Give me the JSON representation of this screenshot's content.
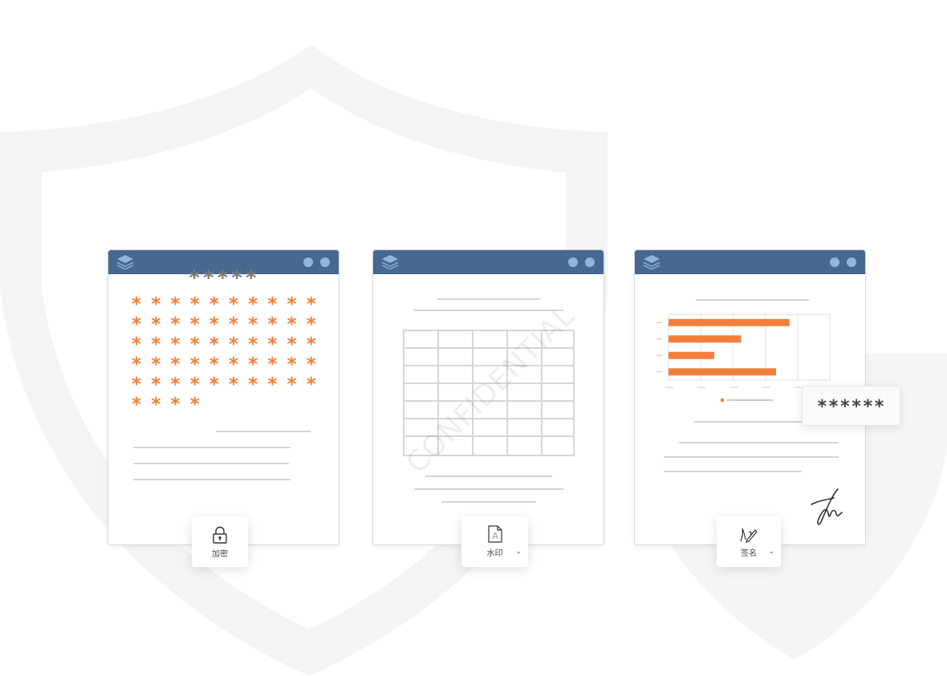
{
  "encrypt_card": {
    "password_mask": "*****",
    "asterisk": "*",
    "asterisk_count": 54
  },
  "watermark_card": {
    "watermark_text": "CONFIDENTIAL"
  },
  "sign_card": {
    "chart_data": {
      "type": "bar",
      "orientation": "horizontal",
      "categories": [
        "",
        "",
        "",
        ""
      ],
      "values": [
        4.5,
        2.7,
        1.7,
        4.0
      ],
      "xlim": [
        0,
        6
      ],
      "grid": true,
      "color": "#f47f3b"
    },
    "password_popup": "******"
  },
  "toolbar": {
    "encrypt_label": "加密",
    "watermark_label": "水印",
    "sign_label": "签名",
    "chevron": "⌄"
  },
  "colors": {
    "titlebar": "#476891",
    "accent": "#f47f3b",
    "window_dot": "#8fb6e0"
  }
}
